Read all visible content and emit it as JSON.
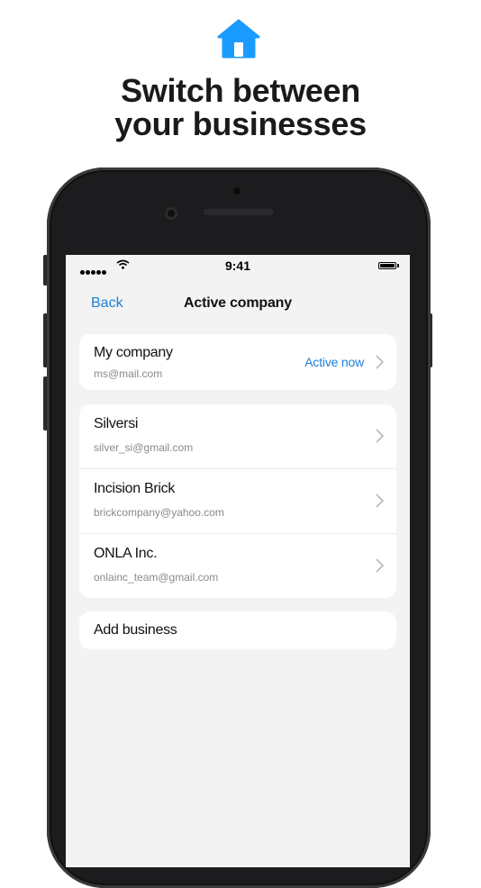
{
  "promo": {
    "icon": "house-icon",
    "headline_line1": "Switch between",
    "headline_line2": "your businesses"
  },
  "status_bar": {
    "time": "9:41",
    "signal_icon": "signal-dots-icon",
    "wifi_icon": "wifi-icon",
    "battery_icon": "battery-icon"
  },
  "nav": {
    "back_label": "Back",
    "title": "Active company"
  },
  "active_company": {
    "name": "My company",
    "email": "ms@mail.com",
    "status_label": "Active now"
  },
  "companies": [
    {
      "name": "Silversi",
      "email": "silver_si@gmail.com"
    },
    {
      "name": "Incision Brick",
      "email": "brickcompany@yahoo.com"
    },
    {
      "name": "ONLA Inc.",
      "email": "onlainc_team@gmail.com"
    }
  ],
  "add_business_label": "Add business",
  "colors": {
    "accent": "#1e7fd6",
    "icon_blue": "#1a9bff",
    "screen_bg": "#f3f3f3",
    "phone_body": "#1c1c1e"
  }
}
